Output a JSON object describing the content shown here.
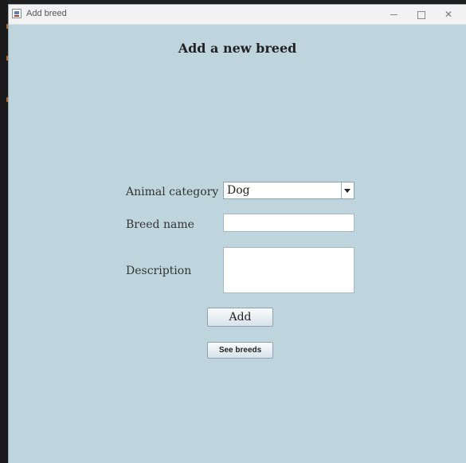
{
  "window": {
    "title": "Add breed"
  },
  "page": {
    "title": "Add a new breed"
  },
  "form": {
    "category_label": "Animal category",
    "category_value": "Dog",
    "breed_label": "Breed name",
    "breed_value": "",
    "description_label": "Description",
    "description_value": ""
  },
  "buttons": {
    "add_label": "Add",
    "see_breeds_label": "See breeds"
  },
  "colors": {
    "background": "#bfd5de",
    "titlebar": "#f2f2f2"
  }
}
